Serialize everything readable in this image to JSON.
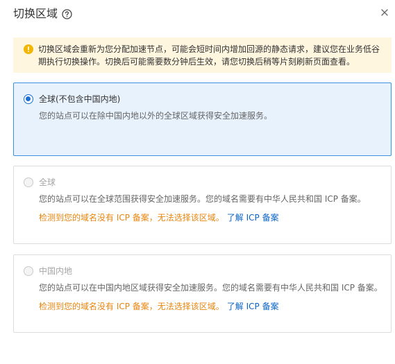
{
  "dialog": {
    "title": "切换区域",
    "help_icon": "question-circle-icon",
    "close_icon": "close-icon"
  },
  "notice": {
    "icon": "warning-icon",
    "text": "切换区域会重新为您分配加速节点，可能会短时间内增加回源的静态请求，建议您在业务低谷期执行切换操作。切换后可能需要数分钟后生效，请您切换后稍等片刻刷新页面查看。",
    "color": "#fff6e0"
  },
  "options": [
    {
      "label": "全球(不包含中国内地)",
      "description": "您的站点可以在除中国内地以外的全球区域获得安全加速服务。",
      "selected": true,
      "disabled": false
    },
    {
      "label": "全球",
      "description": "您的站点可以在全球范围获得安全加速服务。您的域名需要有中华人民共和国 ICP 备案。",
      "warning": "检测到您的域名没有 ICP 备案，无法选择该区域。",
      "link": "了解 ICP 备案",
      "selected": false,
      "disabled": true
    },
    {
      "label": "中国内地",
      "description": "您的站点可以在中国内地区域获得安全加速服务。您的域名需要有中华人民共和国 ICP 备案。",
      "warning": "检测到您的域名没有 ICP 备案，无法选择该区域。",
      "link": "了解 ICP 备案",
      "selected": false,
      "disabled": true
    }
  ],
  "colors": {
    "accent": "#1a6fd4",
    "selected_bg": "#e8f2fd",
    "warning_text": "#e8860e",
    "link": "#0b63c5"
  }
}
